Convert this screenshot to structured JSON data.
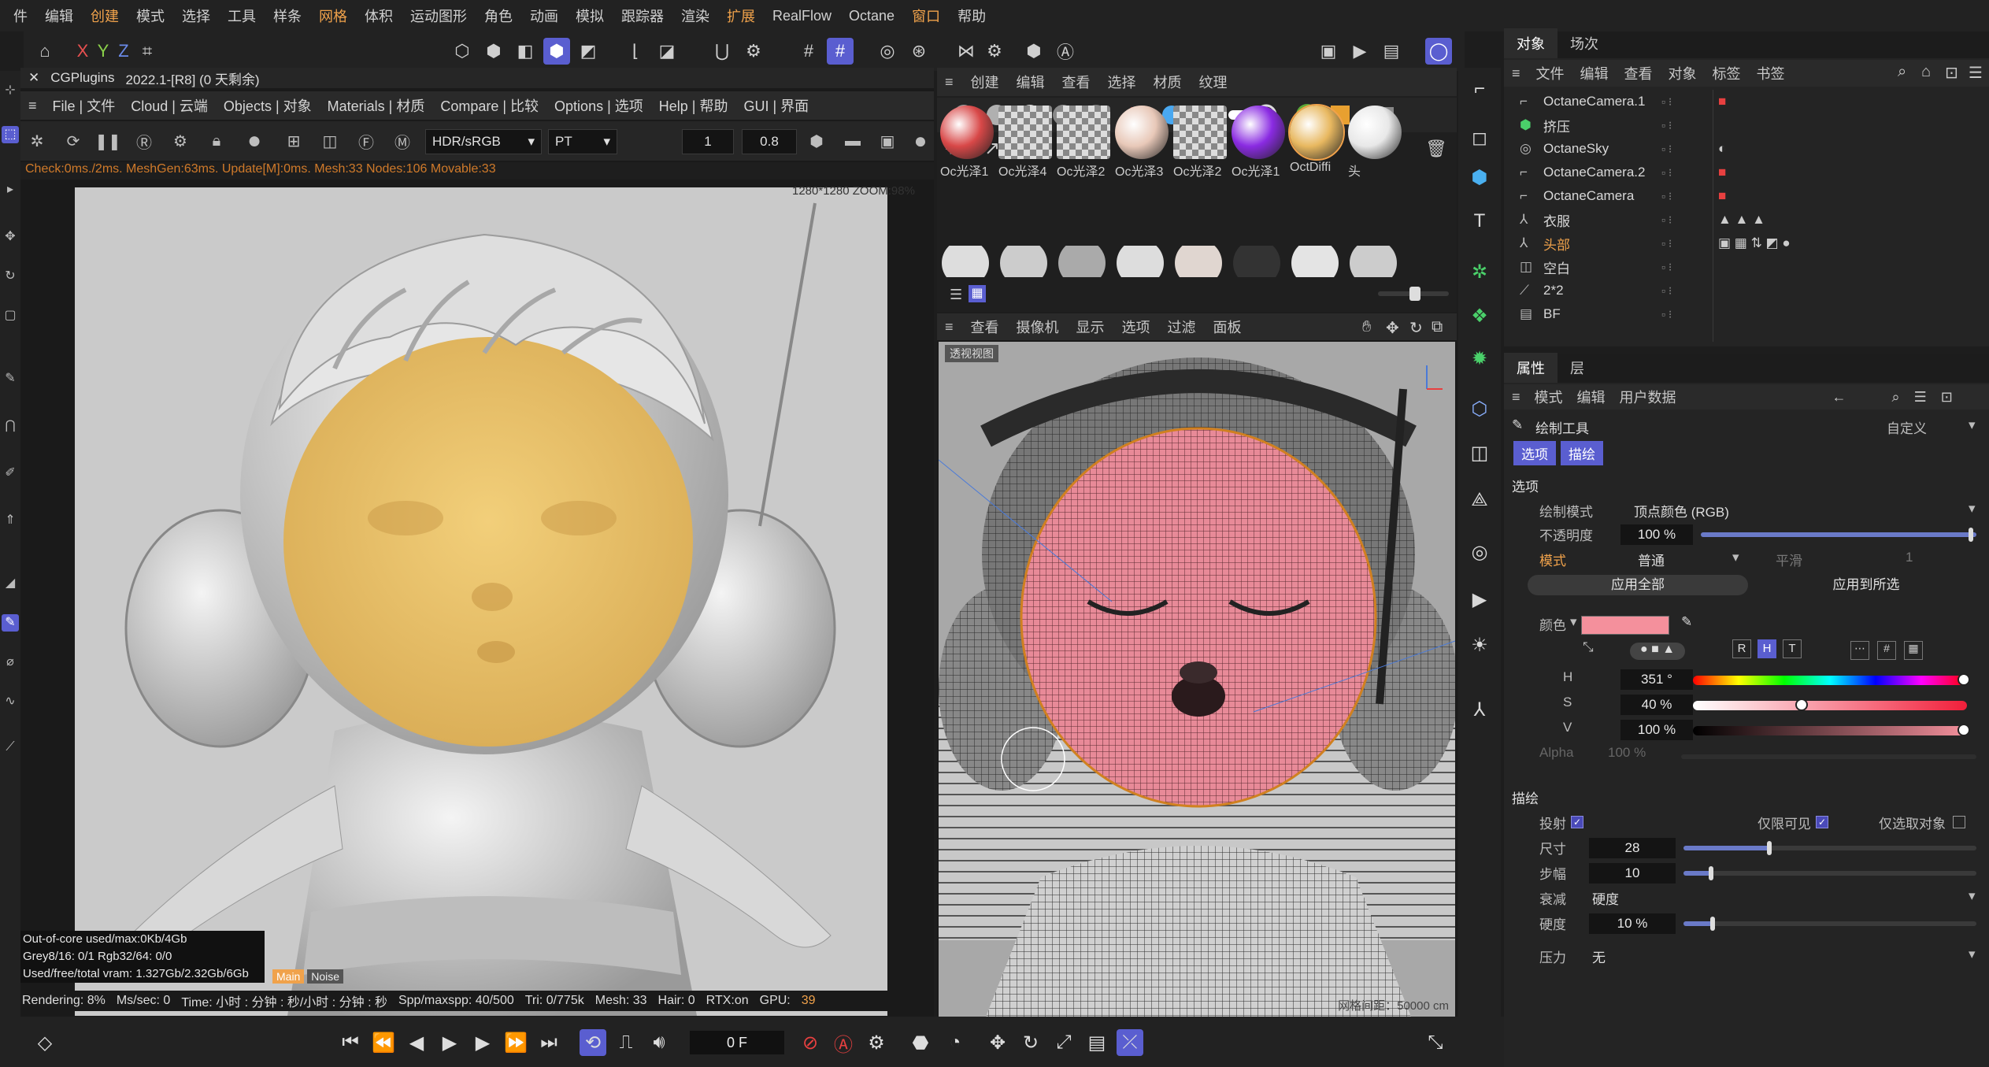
{
  "menubar": {
    "items": [
      "件",
      "编辑",
      "创建",
      "模式",
      "选择",
      "工具",
      "样条",
      "网格",
      "体积",
      "运动图形",
      "角色",
      "动画",
      "模拟",
      "跟踪器",
      "渲染",
      "扩展",
      "RealFlow",
      "Octane",
      "窗口",
      "帮助"
    ],
    "highlight_index": [
      2,
      7,
      15,
      18
    ]
  },
  "toolbar": {
    "axis_x": "X",
    "axis_y": "Y",
    "axis_z": "Z"
  },
  "live_viewer": {
    "title": "CGPlugins",
    "version": "2022.1-[R8] (0 天剩余)",
    "menu": [
      "File | 文件",
      "Cloud | 云端",
      "Objects | 对象",
      "Materials | 材质",
      "Compare | 比较",
      "Options | 选项",
      "Help | 帮助",
      "GUI | 界面"
    ],
    "color_space": "HDR/sRGB",
    "kernel": "PT",
    "field1": "1",
    "field2": "0.8",
    "status_line": "Check:0ms./2ms. MeshGen:63ms. Update[M]:0ms. Mesh:33 Nodes:106 Movable:33",
    "resolution": "1280*1280 ZOOM:98%",
    "ooc": [
      "Out-of-core used/max:0Kb/4Gb",
      "Grey8/16: 0/1          Rgb32/64: 0/0",
      "Used/free/total vram: 1.327Gb/2.32Gb/6Gb"
    ],
    "tab_main": "Main",
    "tab_noise": "Noise",
    "stats": {
      "rendering": "Rendering: 8%",
      "mssec": "Ms/sec: 0",
      "time": "Time: 小时 : 分钟 : 秒/小时 : 分钟 : 秒",
      "spp": "Spp/maxspp: 40/500",
      "tri": "Tri: 0/775k",
      "mesh": "Mesh: 33",
      "hair": "Hair: 0",
      "rtx": "RTX:on",
      "gpu": "GPU:",
      "gpu_val": "39"
    }
  },
  "material_panel": {
    "menu": [
      "创建",
      "编辑",
      "查看",
      "选择",
      "材质",
      "纹理"
    ],
    "materials": [
      {
        "label": "Oc光泽1",
        "color": "#d84848"
      },
      {
        "label": "Oc光泽4",
        "color": "checker"
      },
      {
        "label": "Oc光泽2",
        "color": "checker"
      },
      {
        "label": "Oc光泽3",
        "color": "#e8c8b8"
      },
      {
        "label": "Oc光泽2",
        "color": "checker"
      },
      {
        "label": "Oc光泽1",
        "color": "#8a2be2"
      },
      {
        "label": "OctDiffi",
        "color": "#e8b860"
      },
      {
        "label": "头",
        "color": "#e8e8e8"
      }
    ]
  },
  "viewport": {
    "menu": [
      "查看",
      "摄像机",
      "显示",
      "选项",
      "过滤",
      "面板"
    ],
    "tag": "透视视图",
    "grid_spacing": "网格间距：50000 cm"
  },
  "objects_panel": {
    "tabs": [
      "对象",
      "场次"
    ],
    "menu": [
      "文件",
      "编辑",
      "查看",
      "对象",
      "标签",
      "书签"
    ],
    "items": [
      {
        "name": "OctaneCamera.1",
        "selected": false
      },
      {
        "name": "挤压",
        "selected": false
      },
      {
        "name": "OctaneSky",
        "selected": false
      },
      {
        "name": "OctaneCamera.2",
        "selected": false
      },
      {
        "name": "OctaneCamera",
        "selected": false
      },
      {
        "name": "衣服",
        "selected": false
      },
      {
        "name": "头部",
        "selected": true
      },
      {
        "name": "空白",
        "selected": false
      },
      {
        "name": "2*2",
        "selected": false
      },
      {
        "name": "BF",
        "selected": false
      }
    ]
  },
  "attributes_panel": {
    "tabs": [
      "属性",
      "层"
    ],
    "menu": [
      "模式",
      "编辑",
      "用户数据"
    ],
    "tool_name": "绘制工具",
    "custom": "自定义",
    "subtabs": [
      "选项",
      "描绘"
    ],
    "section_options": "选项",
    "paint_mode_label": "绘制模式",
    "paint_mode_value": "顶点颜色 (RGB)",
    "opacity_label": "不透明度",
    "opacity_value": "100 %",
    "mode_label": "模式",
    "mode_value": "普通",
    "smooth_label": "平滑",
    "smooth_value": "1",
    "apply_all": "应用全部",
    "apply_selected": "应用到所选",
    "color_label": "颜色",
    "color_hex": "#f4909c",
    "h_label": "H",
    "h_value": "351 °",
    "s_label": "S",
    "s_value": "40 %",
    "v_label": "V",
    "v_value": "100 %",
    "alpha_label": "Alpha",
    "alpha_value": "100 %",
    "section_paint": "描绘",
    "project_label": "投射",
    "visible_only_label": "仅限可见",
    "selected_only_label": "仅选取对象",
    "size_label": "尺寸",
    "size_value": "28",
    "step_label": "步幅",
    "step_value": "10",
    "falloff_label": "衰减",
    "falloff_value": "硬度",
    "hardness_label": "硬度",
    "hardness_value": "10 %",
    "pressure_label": "压力",
    "pressure_value": "无",
    "mode_buttons": [
      "R",
      "H",
      "T"
    ]
  },
  "timeline": {
    "frame": "0 F"
  }
}
